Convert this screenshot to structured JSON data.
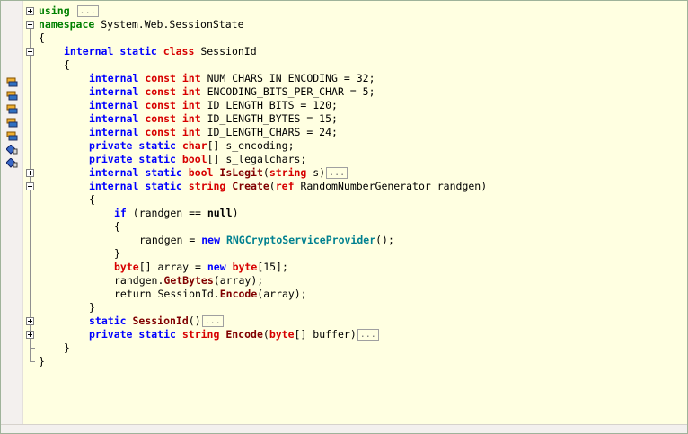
{
  "editor": {
    "lines": [
      {
        "indent": 0,
        "fold": "plus",
        "segments": [
          {
            "t": "using ",
            "c": "kw-green"
          }
        ],
        "pill": "..."
      },
      {
        "indent": 0,
        "fold": "minus",
        "segments": [
          {
            "t": "namespace ",
            "c": "kw-green"
          },
          {
            "t": "System.Web.SessionState",
            "c": ""
          }
        ]
      },
      {
        "indent": 0,
        "segments": [
          {
            "t": "{",
            "c": ""
          }
        ]
      },
      {
        "indent": 1,
        "fold": "minus",
        "segments": [
          {
            "t": "internal ",
            "c": "kw-blue"
          },
          {
            "t": "static ",
            "c": "kw-blue"
          },
          {
            "t": "class ",
            "c": "kw-red"
          },
          {
            "t": "SessionId",
            "c": ""
          }
        ]
      },
      {
        "indent": 1,
        "segments": [
          {
            "t": "{",
            "c": ""
          }
        ]
      },
      {
        "indent": 2,
        "icon": "field-icon",
        "segments": [
          {
            "t": "internal ",
            "c": "kw-blue"
          },
          {
            "t": "const ",
            "c": "kw-red"
          },
          {
            "t": "int ",
            "c": "kw-red"
          },
          {
            "t": "NUM_CHARS_IN_ENCODING = 32;",
            "c": ""
          }
        ]
      },
      {
        "indent": 2,
        "icon": "field-icon",
        "segments": [
          {
            "t": "internal ",
            "c": "kw-blue"
          },
          {
            "t": "const ",
            "c": "kw-red"
          },
          {
            "t": "int ",
            "c": "kw-red"
          },
          {
            "t": "ENCODING_BITS_PER_CHAR = 5;",
            "c": ""
          }
        ]
      },
      {
        "indent": 2,
        "icon": "field-icon",
        "segments": [
          {
            "t": "internal ",
            "c": "kw-blue"
          },
          {
            "t": "const ",
            "c": "kw-red"
          },
          {
            "t": "int ",
            "c": "kw-red"
          },
          {
            "t": "ID_LENGTH_BITS = 120;",
            "c": ""
          }
        ]
      },
      {
        "indent": 2,
        "icon": "field-icon",
        "segments": [
          {
            "t": "internal ",
            "c": "kw-blue"
          },
          {
            "t": "const ",
            "c": "kw-red"
          },
          {
            "t": "int ",
            "c": "kw-red"
          },
          {
            "t": "ID_LENGTH_BYTES = 15;",
            "c": ""
          }
        ]
      },
      {
        "indent": 2,
        "icon": "field-icon",
        "segments": [
          {
            "t": "internal ",
            "c": "kw-blue"
          },
          {
            "t": "const ",
            "c": "kw-red"
          },
          {
            "t": "int ",
            "c": "kw-red"
          },
          {
            "t": "ID_LENGTH_CHARS = 24;",
            "c": ""
          }
        ]
      },
      {
        "indent": 2,
        "icon": "private-field-icon",
        "segments": [
          {
            "t": "private ",
            "c": "kw-blue"
          },
          {
            "t": "static ",
            "c": "kw-blue"
          },
          {
            "t": "char",
            "c": "kw-red"
          },
          {
            "t": "[] s_encoding;",
            "c": ""
          }
        ]
      },
      {
        "indent": 2,
        "icon": "private-field-icon",
        "segments": [
          {
            "t": "private ",
            "c": "kw-blue"
          },
          {
            "t": "static ",
            "c": "kw-blue"
          },
          {
            "t": "bool",
            "c": "kw-red"
          },
          {
            "t": "[] s_legalchars;",
            "c": ""
          }
        ]
      },
      {
        "indent": 2,
        "fold": "plus",
        "segments": [
          {
            "t": "internal ",
            "c": "kw-blue"
          },
          {
            "t": "static ",
            "c": "kw-blue"
          },
          {
            "t": "bool ",
            "c": "kw-red"
          },
          {
            "t": "IsLegit",
            "c": "method"
          },
          {
            "t": "(",
            "c": ""
          },
          {
            "t": "string ",
            "c": "kw-red"
          },
          {
            "t": "s)",
            "c": ""
          }
        ],
        "pill": "..."
      },
      {
        "indent": 2,
        "fold": "minus",
        "segments": [
          {
            "t": "internal ",
            "c": "kw-blue"
          },
          {
            "t": "static ",
            "c": "kw-blue"
          },
          {
            "t": "string ",
            "c": "kw-red"
          },
          {
            "t": "Create",
            "c": "method"
          },
          {
            "t": "(",
            "c": ""
          },
          {
            "t": "ref ",
            "c": "kw-red"
          },
          {
            "t": "RandomNumberGenerator randgen)",
            "c": ""
          }
        ]
      },
      {
        "indent": 2,
        "segments": [
          {
            "t": "{",
            "c": ""
          }
        ]
      },
      {
        "indent": 3,
        "segments": [
          {
            "t": "if ",
            "c": "kw-blue"
          },
          {
            "t": "(randgen == ",
            "c": ""
          },
          {
            "t": "null",
            "c": "kw-plain"
          },
          {
            "t": ")",
            "c": ""
          }
        ]
      },
      {
        "indent": 3,
        "segments": [
          {
            "t": "{",
            "c": ""
          }
        ]
      },
      {
        "indent": 4,
        "segments": [
          {
            "t": "randgen = ",
            "c": ""
          },
          {
            "t": "new ",
            "c": "kw-blue"
          },
          {
            "t": "RNGCryptoServiceProvider",
            "c": "type-teal"
          },
          {
            "t": "();",
            "c": ""
          }
        ]
      },
      {
        "indent": 3,
        "segments": [
          {
            "t": "}",
            "c": ""
          }
        ]
      },
      {
        "indent": 3,
        "segments": [
          {
            "t": "byte",
            "c": "kw-red"
          },
          {
            "t": "[] array = ",
            "c": ""
          },
          {
            "t": "new ",
            "c": "kw-blue"
          },
          {
            "t": "byte",
            "c": "kw-red"
          },
          {
            "t": "[15];",
            "c": ""
          }
        ]
      },
      {
        "indent": 3,
        "segments": [
          {
            "t": "randgen.",
            "c": ""
          },
          {
            "t": "GetBytes",
            "c": "method"
          },
          {
            "t": "(array);",
            "c": ""
          }
        ]
      },
      {
        "indent": 3,
        "segments": [
          {
            "t": "return ",
            "c": ""
          },
          {
            "t": "SessionId.",
            "c": ""
          },
          {
            "t": "Encode",
            "c": "method"
          },
          {
            "t": "(array);",
            "c": ""
          }
        ]
      },
      {
        "indent": 2,
        "segments": [
          {
            "t": "}",
            "c": ""
          }
        ]
      },
      {
        "indent": 2,
        "fold": "plus",
        "segments": [
          {
            "t": "static ",
            "c": "kw-blue"
          },
          {
            "t": "SessionId",
            "c": "ctor"
          },
          {
            "t": "()",
            "c": ""
          }
        ],
        "pill": "..."
      },
      {
        "indent": 2,
        "fold": "plus",
        "segments": [
          {
            "t": "private ",
            "c": "kw-blue"
          },
          {
            "t": "static ",
            "c": "kw-blue"
          },
          {
            "t": "string ",
            "c": "kw-red"
          },
          {
            "t": "Encode",
            "c": "method"
          },
          {
            "t": "(",
            "c": ""
          },
          {
            "t": "byte",
            "c": "kw-red"
          },
          {
            "t": "[] buffer)",
            "c": ""
          }
        ],
        "pill": "..."
      },
      {
        "indent": 1,
        "segments": [
          {
            "t": "}",
            "c": ""
          }
        ]
      },
      {
        "indent": 0,
        "segments": [
          {
            "t": "}",
            "c": ""
          }
        ]
      }
    ]
  },
  "colors": {
    "background": "#ffffe1",
    "keyword": "#0000ff",
    "type_keyword": "#d70000",
    "namespace_keyword": "#008000"
  }
}
